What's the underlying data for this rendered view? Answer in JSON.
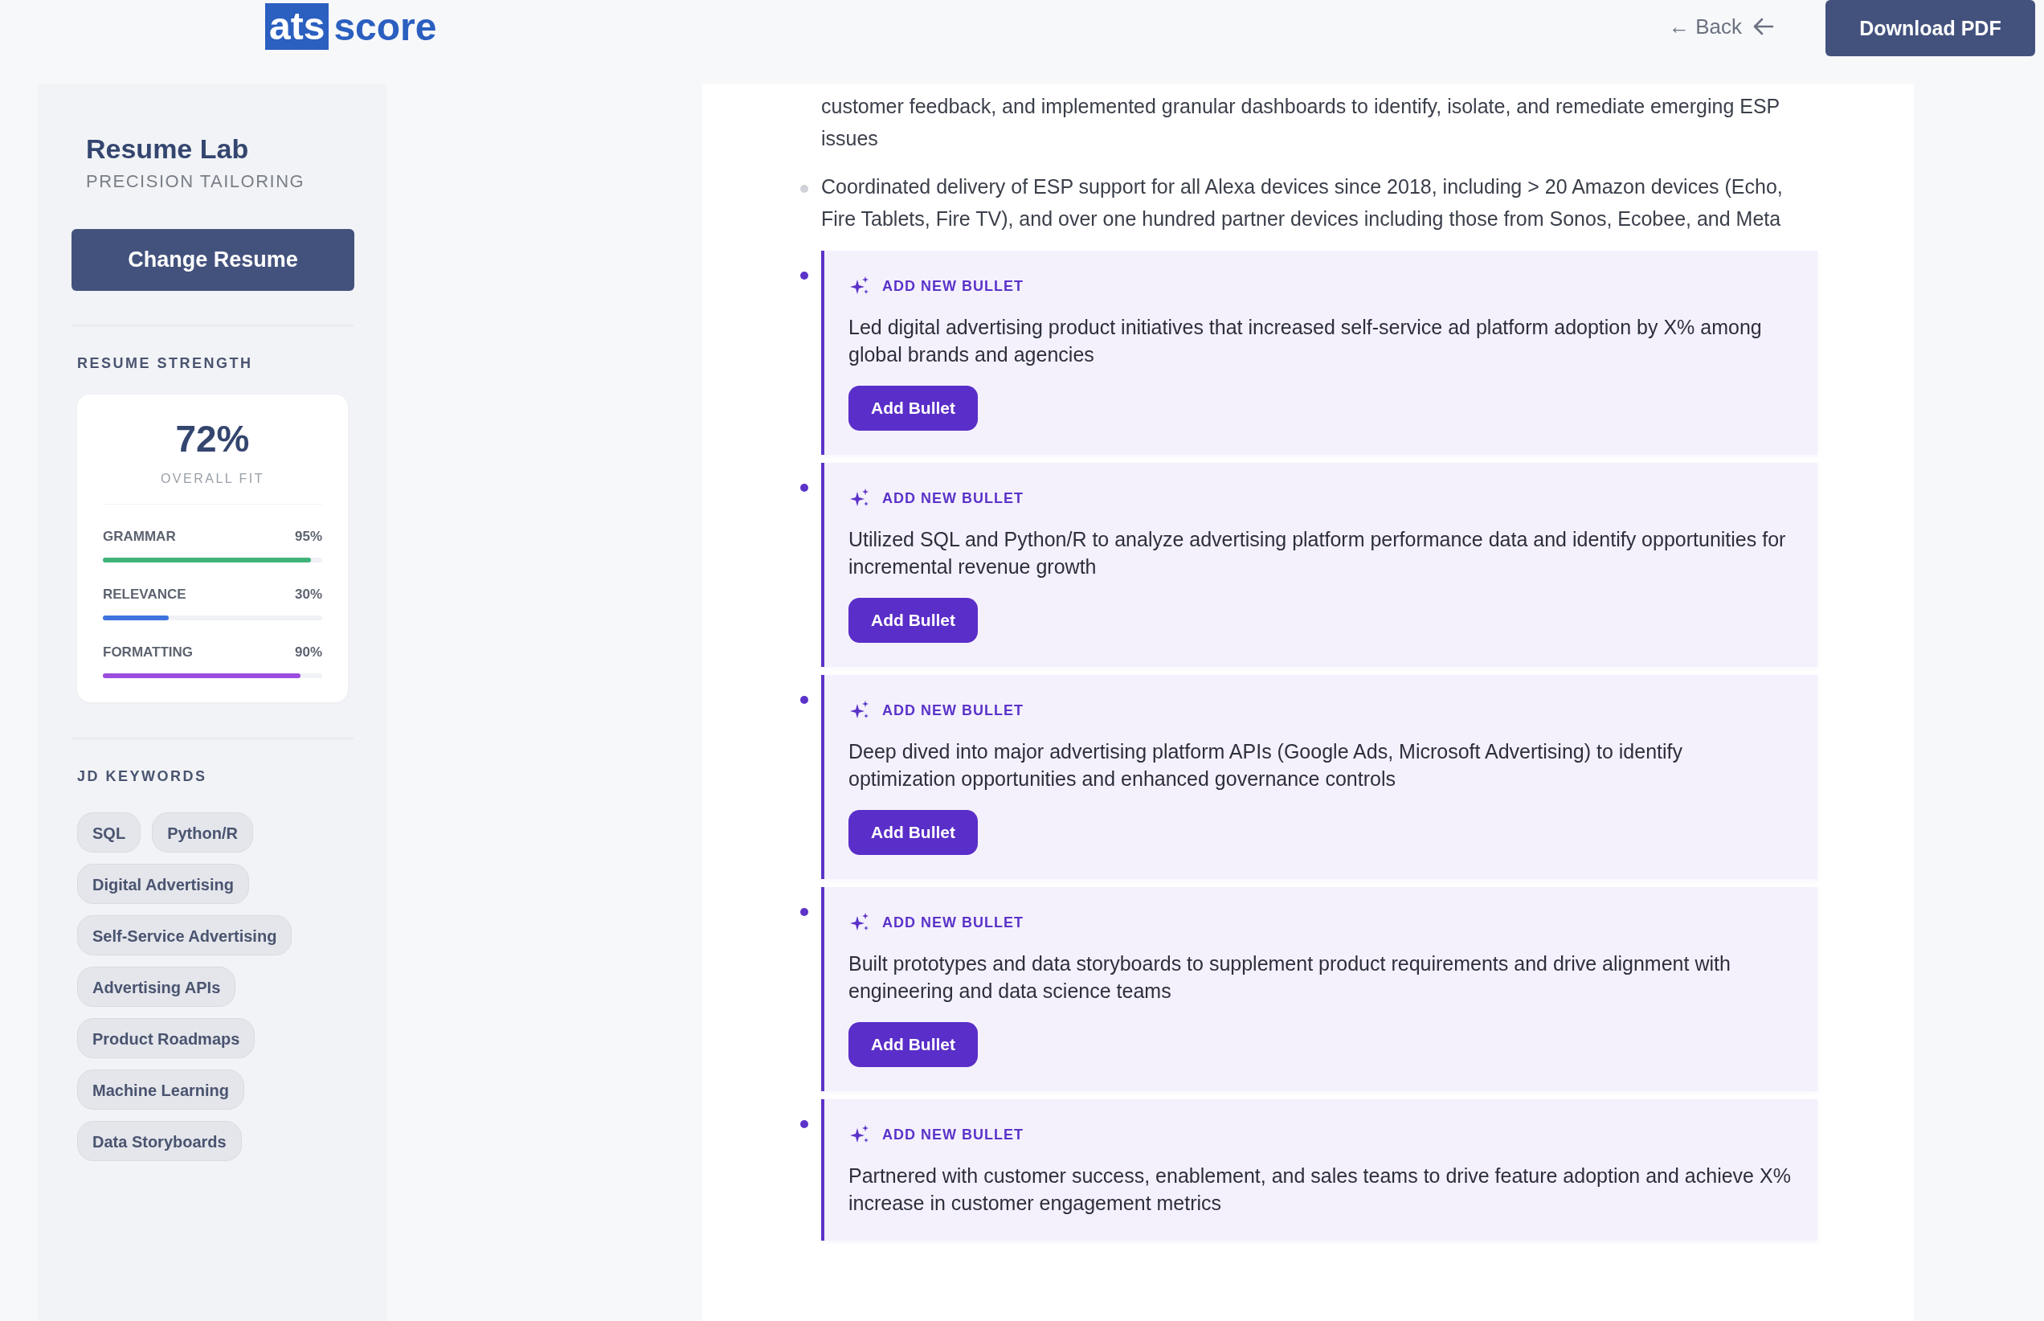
{
  "header": {
    "logo": {
      "mark": "ats",
      "word": "score"
    },
    "back_link": "← Back",
    "download_button": "Download PDF"
  },
  "sidebar": {
    "title": "Resume Lab",
    "subtitle": "PRECISION TAILORING",
    "change_button": "Change Resume",
    "strength": {
      "heading": "RESUME STRENGTH",
      "overall": "72%",
      "overall_label": "OVERALL FIT",
      "metrics": [
        {
          "name": "GRAMMAR",
          "value": "95%",
          "level": 0.95,
          "color": "#3fb37a"
        },
        {
          "name": "RELEVANCE",
          "value": "30%",
          "level": 0.3,
          "color": "#3f73de"
        },
        {
          "name": "FORMATTING",
          "value": "90%",
          "level": 0.9,
          "color": "#9b4ddf"
        }
      ]
    },
    "keywords": {
      "heading": "JD KEYWORDS",
      "chips": [
        "SQL",
        "Python/R",
        "Digital Advertising",
        "Self-Service Advertising",
        "Advertising APIs",
        "Product Roadmaps",
        "Machine Learning",
        "Data Storyboards"
      ]
    }
  },
  "resume": {
    "bullets": [
      {
        "kind": "continuation",
        "text": "customer feedback, and implemented granular dashboards to identify, isolate, and remediate emerging ESP issues"
      },
      {
        "kind": "text",
        "text": "Coordinated delivery of ESP support for all Alexa devices since 2018, including > 20 Amazon devices (Echo, Fire Tablets, Fire TV), and over one hundred partner devices including those from Sonos, Ecobee, and Meta"
      },
      {
        "kind": "suggestion",
        "label": "ADD NEW BULLET",
        "text": "Led digital advertising product initiatives that increased self-service ad platform adoption by X% among global brands and agencies",
        "button": "Add Bullet"
      },
      {
        "kind": "suggestion",
        "label": "ADD NEW BULLET",
        "text": "Utilized SQL and Python/R to analyze advertising platform performance data and identify opportunities for incremental revenue growth",
        "button": "Add Bullet"
      },
      {
        "kind": "suggestion",
        "label": "ADD NEW BULLET",
        "text": "Deep dived into major advertising platform APIs (Google Ads, Microsoft Advertising) to identify optimization opportunities and enhanced governance controls",
        "button": "Add Bullet"
      },
      {
        "kind": "suggestion",
        "label": "ADD NEW BULLET",
        "text": "Built prototypes and data storyboards to supplement product requirements and drive alignment with engineering and data science teams",
        "button": "Add Bullet"
      },
      {
        "kind": "suggestion",
        "label": "ADD NEW BULLET",
        "text": "Partnered with customer success, enablement, and sales teams to drive feature adoption and achieve X% increase in customer engagement metrics"
      }
    ]
  }
}
